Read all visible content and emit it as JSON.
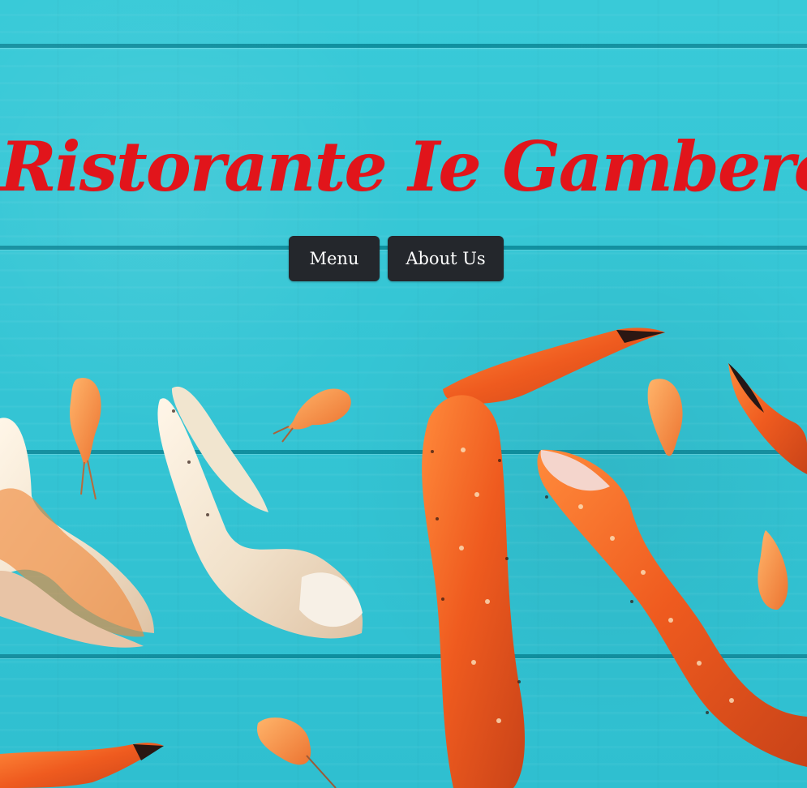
{
  "page": {
    "title": "Ristorante Ie Gambero Rosso"
  },
  "navigation": {
    "buttons": [
      {
        "label": "Menu"
      },
      {
        "label": "About Us"
      }
    ]
  },
  "colors": {
    "background_teal": "#33c4d4",
    "plank_lines": "#00798d",
    "title_red": "#e1151b",
    "button_dark": "#24272c",
    "crab_orange": "#f46b25",
    "shell_cream": "#f4e8d7"
  },
  "visual": {
    "background_image": "crab claws and shrimp on teal wooden planks"
  }
}
